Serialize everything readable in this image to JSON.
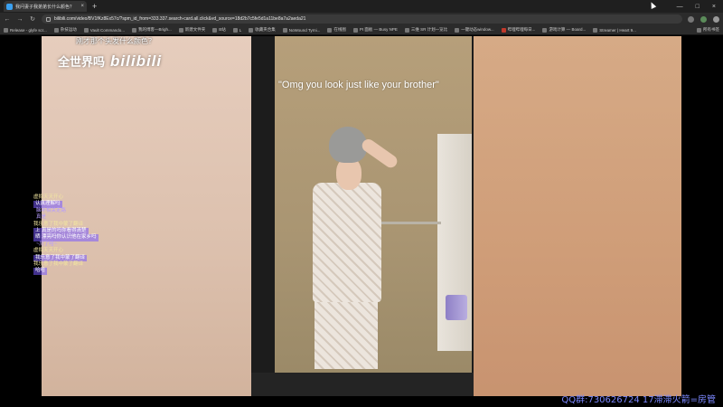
{
  "browser": {
    "tab_title": "我问妻子我弟弟长什么颜色？",
    "tab_close": "×",
    "new_tab": "+",
    "window_controls": [
      "—",
      "□",
      "×"
    ],
    "url": "bilibili.com/video/BV1fKz8Ex57c/?spm_id_from=333.337.search-card.all.click&vd_source=18d2b7c5fe5d1a11be8a7a2aeda21",
    "nav": {
      "back": "←",
      "forward": "→",
      "reload": "↻"
    },
    "bookmarks": [
      "Release - glyfe scr...",
      "杂技运动",
      "Vault Commando...",
      "我的博客—Brigh...",
      "新建文件夹",
      "B站",
      "L",
      "收藏夹合集",
      "NoWound Tyrni...",
      "在线图",
      "PI 面板 — Busy NPE",
      "三维 SR 计划一览比",
      "一键动态window...",
      "哔哩哔哩每日...",
      "游戏计算 — Board...",
      "Streamer | Heart 9..."
    ],
    "bookmarks_right": "所有书签"
  },
  "video": {
    "caption": "\"Omg you look just like your brother\"",
    "watermark_question": "刚才那个头发什么颜色？",
    "watermark_main": "全世界吗",
    "watermark_logo": "bilibili"
  },
  "chat": [
    {
      "user": "虚拟天天开心",
      "msg": "认真理解吗",
      "highlight": true
    },
    {
      "user": "",
      "msg": "脑补相关走路",
      "highlight": false
    },
    {
      "user": "",
      "msg": "真是",
      "highlight": false
    },
    {
      "user": "我乐意了我中蒙了翻译",
      "msg": "",
      "highlight": false
    },
    {
      "user": "",
      "msg": "上 真是的吗你看得清楚",
      "highlight": true
    },
    {
      "user": "",
      "msg": "晒 漂亮吗你认识他在家乡吗",
      "highlight": true
    },
    {
      "user": "",
      "msg": "~厉了哈~",
      "highlight": false
    },
    {
      "user": "虚拟天天开心",
      "msg": "",
      "highlight": false
    },
    {
      "user": "",
      "msg": "我乐意了我中蒙了翻译",
      "highlight": true
    },
    {
      "user": "我乐意了我中蒙了翻译",
      "msg": "",
      "highlight": false
    },
    {
      "user": "",
      "msg": "哈哈",
      "highlight": true
    }
  ],
  "ticker": "QQ群:730626724  17滞滞火箭=房管"
}
